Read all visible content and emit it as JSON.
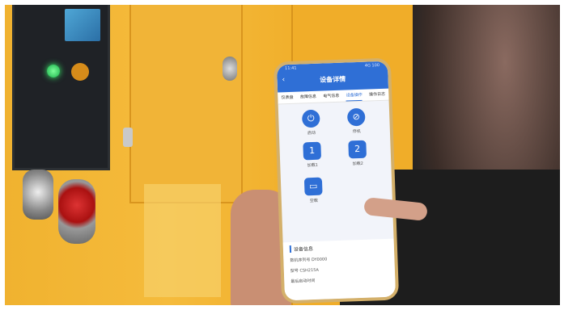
{
  "phone": {
    "status_time": "11:41",
    "status_right": "4G 100",
    "back_icon": "chevron-left-icon",
    "title": "设备详情",
    "tabs": [
      {
        "label": "仪表盘",
        "active": false
      },
      {
        "label": "故障信息",
        "active": false
      },
      {
        "label": "电气信息",
        "active": false
      },
      {
        "label": "设备操作",
        "active": true
      },
      {
        "label": "操作日志",
        "active": false
      }
    ],
    "operations": [
      {
        "label": "启动",
        "icon": "power-icon",
        "glyph": "⏻"
      },
      {
        "label": "停机",
        "icon": "stop-icon",
        "glyph": "⊘"
      },
      {
        "label": "加载1",
        "icon": "load1-icon",
        "glyph": "1"
      },
      {
        "label": "加载2",
        "icon": "load2-icon",
        "glyph": "2"
      },
      {
        "label": "空载",
        "icon": "idle-icon",
        "glyph": "▭"
      }
    ],
    "info": {
      "title": "设备信息",
      "rows": [
        "数机序列号 DY0000",
        "型号 CSH215A",
        "最后启动时间"
      ]
    }
  },
  "colors": {
    "accent": "#2f6fd6",
    "cabinet": "#f0b22f"
  }
}
